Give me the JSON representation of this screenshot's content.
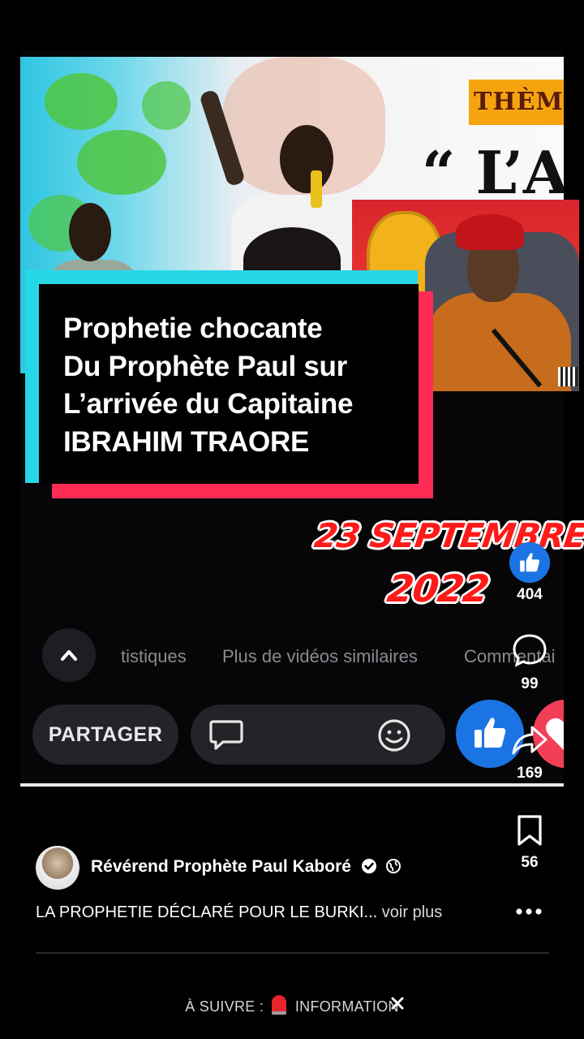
{
  "overlay": {
    "headline": [
      "Prophetie chocante",
      "Du Prophète Paul sur",
      "L’arrivée du Capitaine",
      "IBRAHIM TRAORE"
    ],
    "date_line1": "23 SEPTEMBRE",
    "date_line2": "2022",
    "background_text": {
      "theme_badge": "THÈMI",
      "quote": "“ L’A"
    }
  },
  "facebook_ui": {
    "tabs": [
      "tistiques",
      "Plus de vidéos similaires",
      "Commentai"
    ],
    "share_label": "PARTAGER",
    "like_count": "169"
  },
  "rail": {
    "likes": "404",
    "comments": "99",
    "saves": "56"
  },
  "post": {
    "author": "Révérend Prophète Paul Kaboré",
    "caption": "LA PROPHETIE DÉCLARÉ POUR LE BURKI...",
    "see_more": "voir plus"
  },
  "up_next": {
    "prefix": "À SUIVRE :",
    "title": "INFORMATION"
  },
  "colors": {
    "accent_red": "#fe2c55",
    "accent_cyan": "#27d7e8",
    "facebook_blue": "#1b74e4"
  },
  "icons": [
    "chevron-up-icon",
    "comment-icon",
    "emoji-icon",
    "thumbs-up-icon",
    "heart-icon",
    "share-icon",
    "bookmark-icon",
    "more-icon",
    "verified-icon",
    "globe-icon",
    "siren-icon",
    "close-icon"
  ]
}
